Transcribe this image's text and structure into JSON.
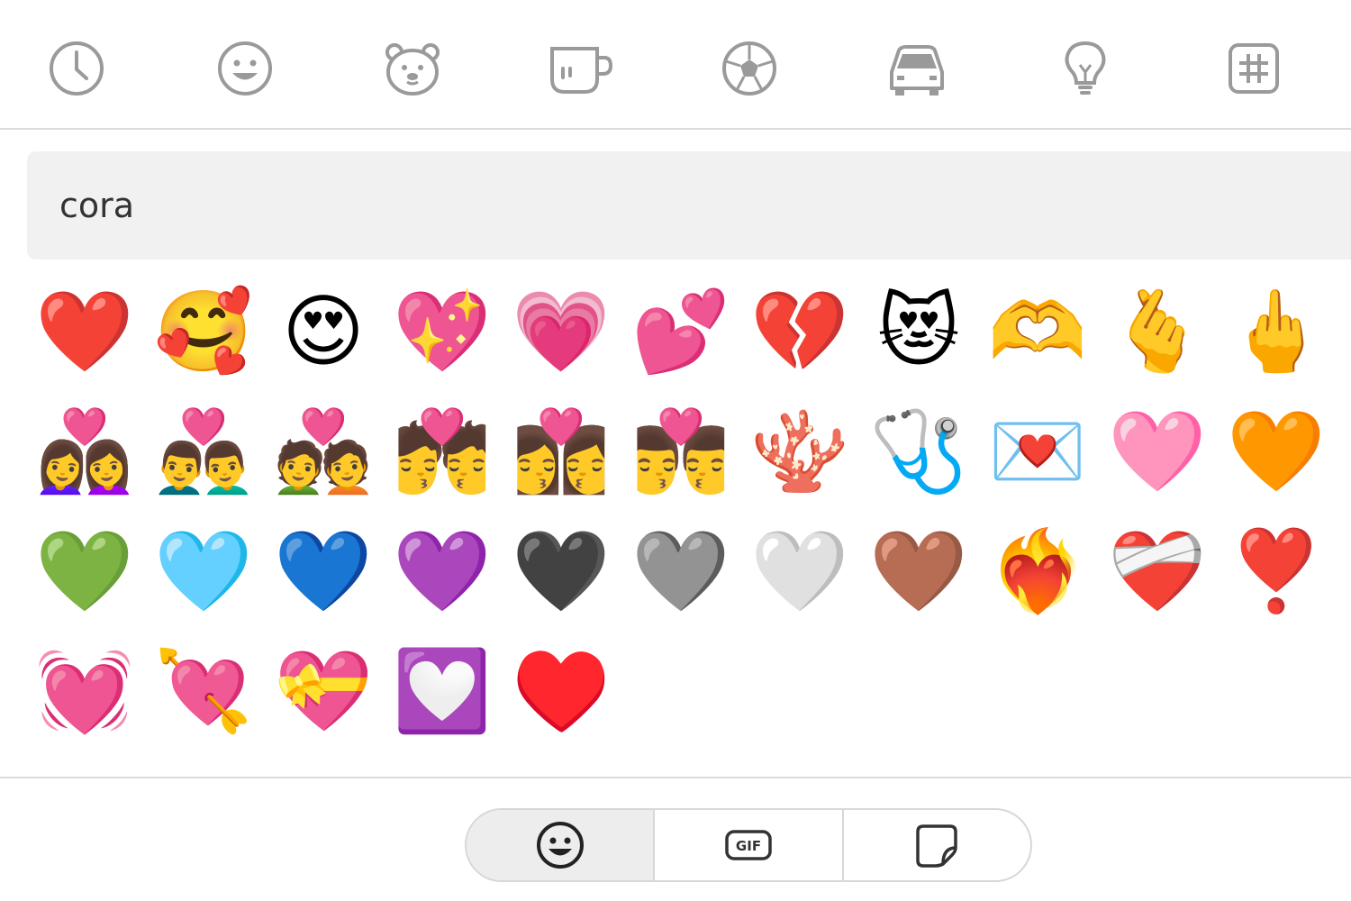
{
  "categories": [
    {
      "name": "recent",
      "icon": "clock-icon"
    },
    {
      "name": "smileys",
      "icon": "smiley-icon"
    },
    {
      "name": "animals",
      "icon": "bear-icon"
    },
    {
      "name": "food",
      "icon": "cup-icon"
    },
    {
      "name": "activities",
      "icon": "soccer-ball-icon"
    },
    {
      "name": "travel",
      "icon": "car-icon"
    },
    {
      "name": "objects",
      "icon": "lightbulb-icon"
    },
    {
      "name": "symbols",
      "icon": "hashtag-icon"
    }
  ],
  "search": {
    "value": "cora"
  },
  "results": [
    "❤️",
    "🥰",
    "😍",
    "💖",
    "💗",
    "💕",
    "💔",
    "😻",
    "🫶",
    "🫰",
    "🖕",
    "👩‍❤️‍👩",
    "👨‍❤️‍👨",
    "💑",
    "💏",
    "👩‍❤️‍💋‍👩",
    "👨‍❤️‍💋‍👨",
    "🪸",
    "🩺",
    "💌",
    "🩷",
    "🧡",
    "💚",
    "🩵",
    "💙",
    "💜",
    "🖤",
    "🩶",
    "🤍",
    "🤎",
    "❤️‍🔥",
    "❤️‍🩹",
    "❣️",
    "💓",
    "💘",
    "💝",
    "💟",
    "♥️"
  ],
  "bottom_tabs": [
    {
      "name": "emoji",
      "icon": "smiley-icon",
      "active": true
    },
    {
      "name": "gif",
      "icon": "gif-icon",
      "label": "GIF",
      "active": false
    },
    {
      "name": "sticker",
      "icon": "sticker-icon",
      "active": false
    }
  ],
  "colors": {
    "icon_gray": "#9a9a9a",
    "search_bg": "#f1f1f1",
    "active_tab_bg": "#ededed"
  }
}
